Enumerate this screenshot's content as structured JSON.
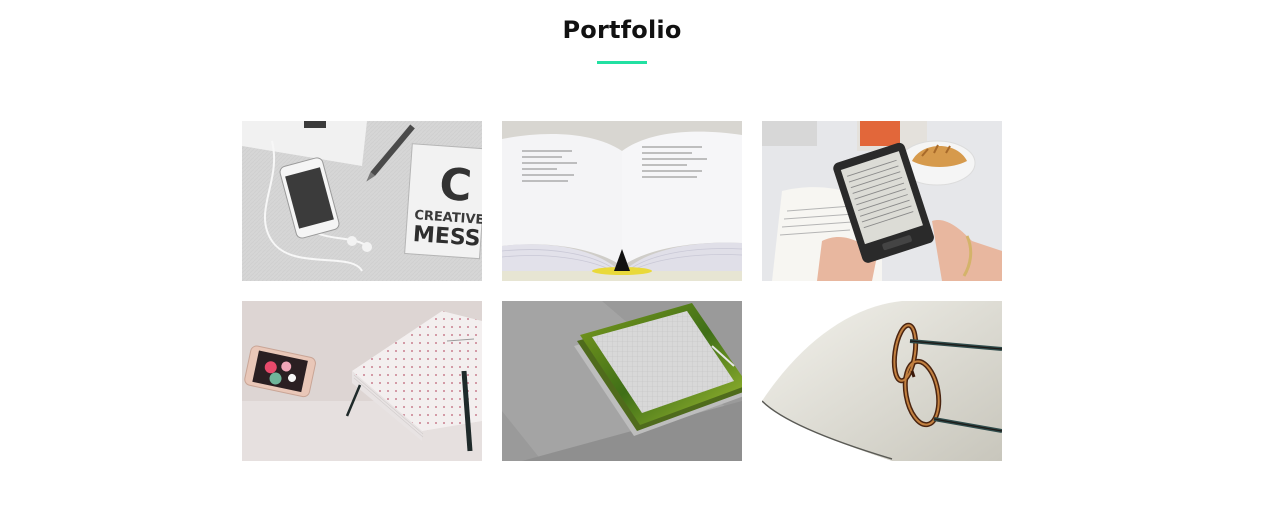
{
  "section": {
    "title": "Portfolio",
    "accent_color": "#22e0a2"
  },
  "portfolio": {
    "items": [
      {
        "image": "phone-earbuds-creative-mess-notebook",
        "text": "CREATIVE MESS",
        "letter": "C"
      },
      {
        "image": "open-book"
      },
      {
        "image": "e-reader-croissant"
      },
      {
        "image": "phone-dotted-notebook"
      },
      {
        "image": "tablet-mockup"
      },
      {
        "image": "glasses-on-laptop"
      }
    ]
  }
}
